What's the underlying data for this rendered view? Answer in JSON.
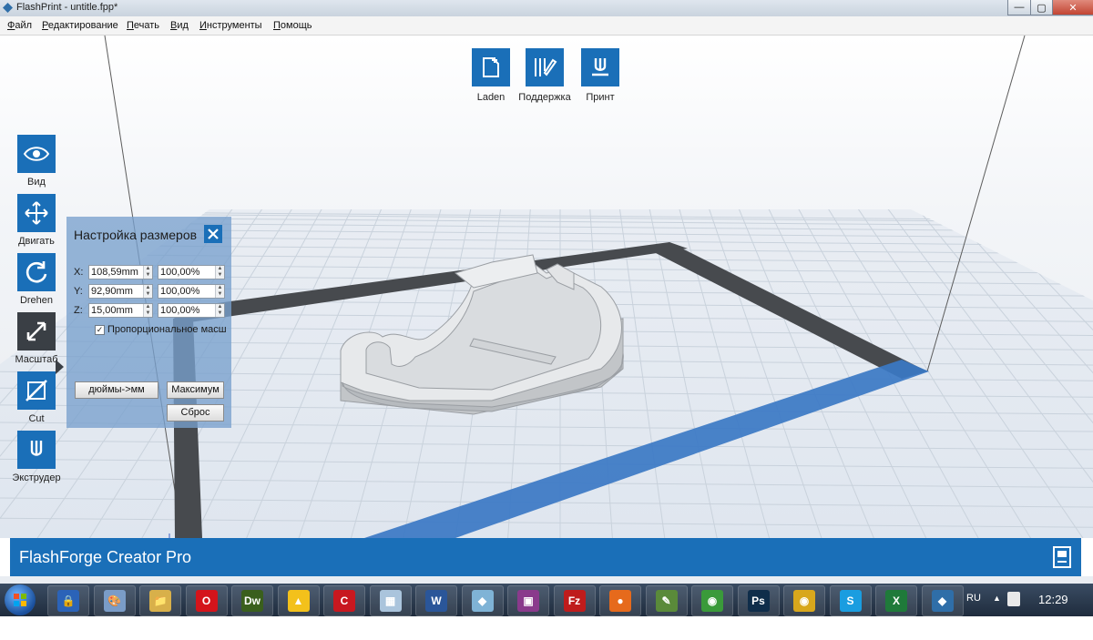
{
  "window": {
    "title": "FlashPrint - untitle.fpp*",
    "controls": {
      "minimize": "—",
      "maximize": "▢",
      "close": "✕"
    }
  },
  "menu": {
    "items": [
      "Файл",
      "Редактирование",
      "Печать",
      "Вид",
      "Инструменты",
      "Помощь"
    ]
  },
  "top_toolbar": {
    "load_label": "Laden",
    "support_label": "Поддержка",
    "print_label": "Принт"
  },
  "left_toolbar": {
    "items": [
      "Вид",
      "Двигать",
      "Drehen",
      "Масштаб",
      "Cut",
      "Экструдер"
    ],
    "active": "Масштаб"
  },
  "scale_panel": {
    "title": "Настройка размеров",
    "x_label": "X:",
    "y_label": "Y:",
    "z_label": "Z:",
    "x_mm": "108,59mm",
    "x_pct": "100,00%",
    "y_mm": "92,90mm",
    "y_pct": "100,00%",
    "z_mm": "15,00mm",
    "z_pct": "100,00%",
    "proportional_label": "Пропорциональное масш",
    "proportional_checked": true,
    "inches_to_mm_label": "дюймы->мм",
    "maximum_label": "Максимум",
    "reset_label": "Сброс"
  },
  "printer_bar": {
    "printer_name": "FlashForge Creator Pro"
  },
  "taskbar": {
    "apps": [
      {
        "name": "security-app",
        "glyph": "🔒",
        "color": "#2b63b8"
      },
      {
        "name": "paint-app",
        "glyph": "🎨",
        "color": "#7a9cc7"
      },
      {
        "name": "explorer-app",
        "glyph": "📁",
        "color": "#d8b04a"
      },
      {
        "name": "opera-app",
        "glyph": "O",
        "color": "#d4141b"
      },
      {
        "name": "dreamweaver-app",
        "glyph": "Dw",
        "color": "#3a5f1d"
      },
      {
        "name": "app-yellow",
        "glyph": "▲",
        "color": "#f3c11b"
      },
      {
        "name": "app-red",
        "glyph": "C",
        "color": "#c8181f"
      },
      {
        "name": "calculator-app",
        "glyph": "▦",
        "color": "#aac4dc"
      },
      {
        "name": "word-app",
        "glyph": "W",
        "color": "#2a5699"
      },
      {
        "name": "app-glass",
        "glyph": "◆",
        "color": "#7fb3d6"
      },
      {
        "name": "winrar-app",
        "glyph": "▣",
        "color": "#8a3a8c"
      },
      {
        "name": "filezilla-app",
        "glyph": "Fz",
        "color": "#bf1c1c"
      },
      {
        "name": "firefox-app",
        "glyph": "●",
        "color": "#e66a1c"
      },
      {
        "name": "notepad-app",
        "glyph": "✎",
        "color": "#5a8a3a"
      },
      {
        "name": "chrome-app",
        "glyph": "◉",
        "color": "#3a9a3a"
      },
      {
        "name": "photoshop-app",
        "glyph": "Ps",
        "color": "#0f2d4a"
      },
      {
        "name": "chrome-app-2",
        "glyph": "◉",
        "color": "#d8a71c"
      },
      {
        "name": "skype-app",
        "glyph": "S",
        "color": "#1a9de0"
      },
      {
        "name": "excel-app",
        "glyph": "X",
        "color": "#1f7a3a"
      },
      {
        "name": "flashprint-app",
        "glyph": "◆",
        "color": "#2f6ea8"
      }
    ],
    "lang": "RU",
    "clock": "12:29"
  },
  "colors": {
    "accent": "#1a6fb8",
    "active_tool": "#3a3f45"
  }
}
